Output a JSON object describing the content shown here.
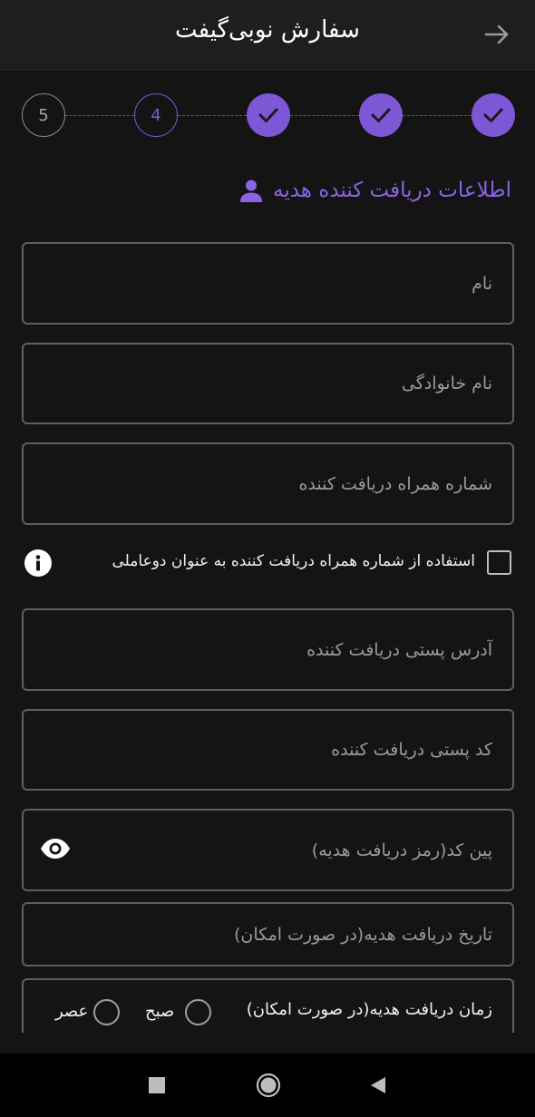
{
  "header": {
    "title": "سفارش نوبی‌گیفت",
    "back_icon": "arrow-right-icon"
  },
  "stepper": {
    "steps": [
      {
        "label": "5",
        "state": "pending"
      },
      {
        "label": "4",
        "state": "current"
      },
      {
        "label": "",
        "state": "done",
        "icon": "check-icon"
      },
      {
        "label": "",
        "state": "done",
        "icon": "check-icon"
      },
      {
        "label": "",
        "state": "done",
        "icon": "check-icon"
      }
    ]
  },
  "section": {
    "title": "اطلاعات دریافت کننده هدیه",
    "icon": "person-icon"
  },
  "form": {
    "first_name_placeholder": "نام",
    "last_name_placeholder": "نام خانوادگی",
    "phone_placeholder": "شماره همراه دریافت کننده",
    "two_factor_checkbox_label": "استفاده از شماره همراه دریافت کننده به عنوان دوعاملی",
    "two_factor_checked": false,
    "address_placeholder": "آدرس پستی دریافت کننده",
    "postal_code_placeholder": "کد پستی دریافت کننده",
    "pin_placeholder": "پین کد(رمز دریافت هدیه)",
    "date_placeholder": "تاریخ دریافت هدیه(در صورت امکان)",
    "time_label": "زمان دریافت هدیه(در صورت امکان)",
    "time_options": [
      "صبح",
      "عصر"
    ]
  },
  "colors": {
    "accent": "#7e57d6",
    "background": "#141414",
    "header_bg": "#1e1e1e",
    "field_border": "#5f5f5f",
    "placeholder": "#9a9a9a"
  },
  "system_nav": {
    "icons": [
      "recents-square-icon",
      "home-circle-icon",
      "back-triangle-icon"
    ]
  }
}
